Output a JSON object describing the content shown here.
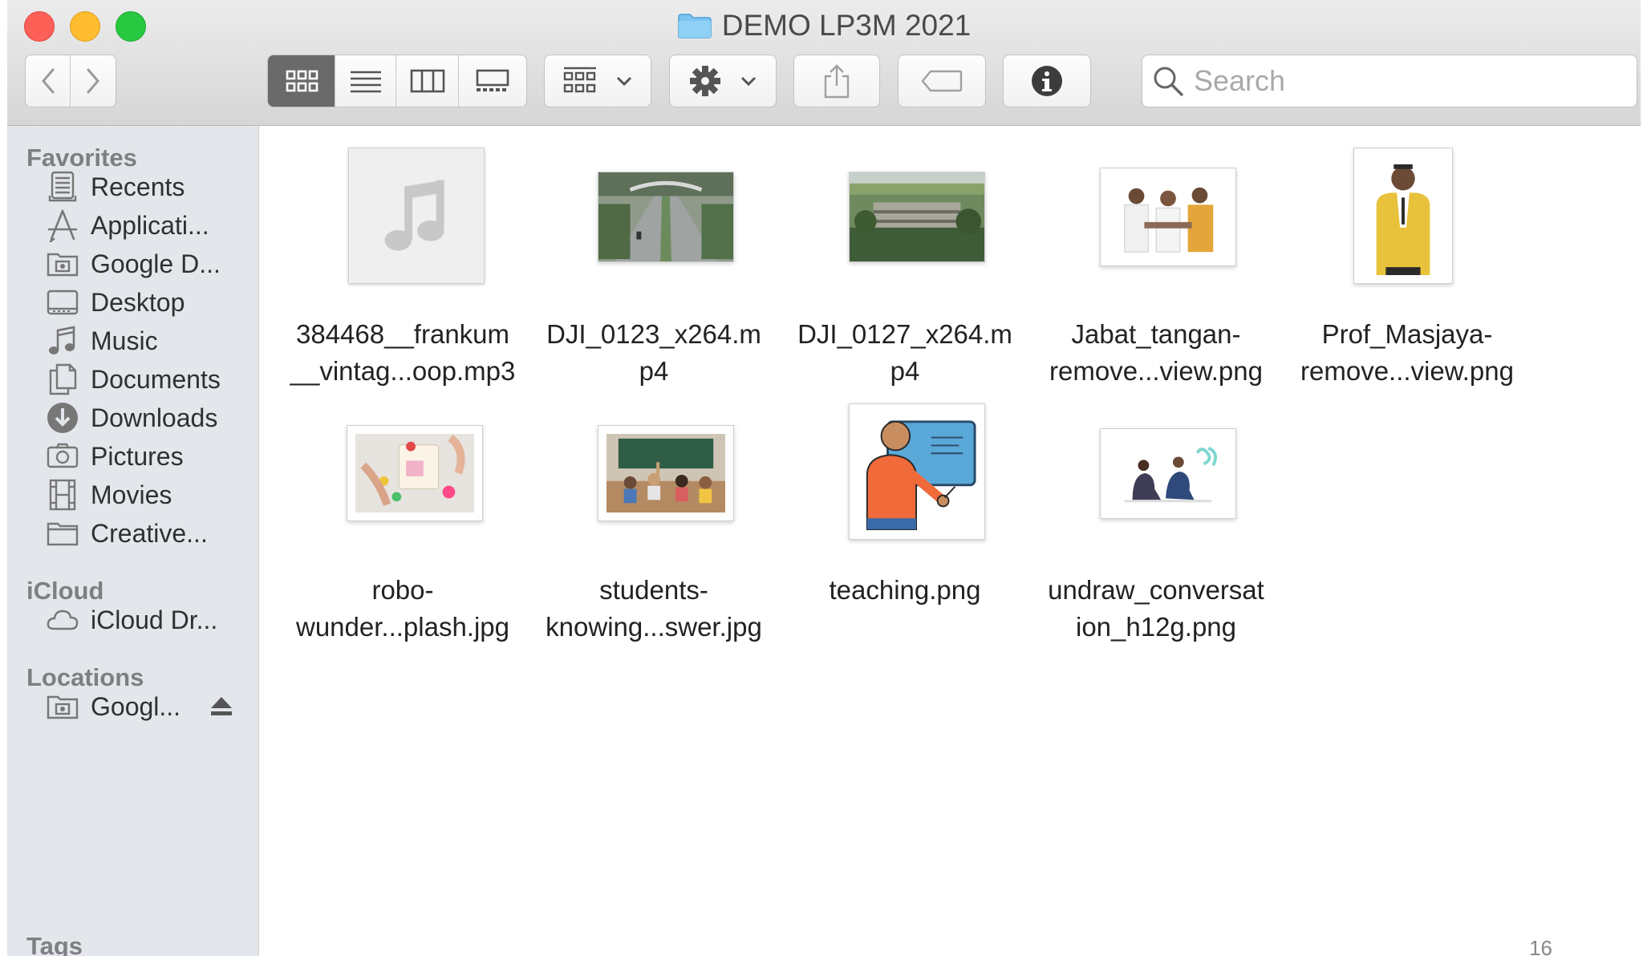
{
  "window": {
    "title": "DEMO LP3M 2021"
  },
  "toolbar": {
    "search_placeholder": "Search"
  },
  "sidebar": {
    "favorites_header": "Favorites",
    "favorites": [
      {
        "label": "Recents",
        "icon": "recents-icon"
      },
      {
        "label": "Applicati...",
        "icon": "applications-icon"
      },
      {
        "label": "Google D...",
        "icon": "drive-folder-icon"
      },
      {
        "label": "Desktop",
        "icon": "desktop-icon"
      },
      {
        "label": "Music",
        "icon": "music-note-icon"
      },
      {
        "label": "Documents",
        "icon": "documents-icon"
      },
      {
        "label": "Downloads",
        "icon": "downloads-icon"
      },
      {
        "label": "Pictures",
        "icon": "camera-icon"
      },
      {
        "label": "Movies",
        "icon": "film-icon"
      },
      {
        "label": "Creative...",
        "icon": "folder-icon"
      }
    ],
    "icloud_header": "iCloud",
    "icloud": [
      {
        "label": "iCloud Dr...",
        "icon": "cloud-icon"
      }
    ],
    "locations_header": "Locations",
    "locations": [
      {
        "label": "Googl...",
        "icon": "drive-folder-icon"
      }
    ],
    "tags_header": "Tags"
  },
  "files": [
    {
      "line1": "384468__frankum",
      "line2": "__vintag...oop.mp3",
      "kind": "audio"
    },
    {
      "line1": "DJI_0123_x264.m",
      "line2": "p4",
      "kind": "video-road"
    },
    {
      "line1": "DJI_0127_x264.m",
      "line2": "p4",
      "kind": "video-building"
    },
    {
      "line1": "Jabat_tangan-",
      "line2": "remove...view.png",
      "kind": "image-people"
    },
    {
      "line1": "Prof_Masjaya-",
      "line2": "remove...view.png",
      "kind": "image-portrait"
    },
    {
      "line1": "robo-",
      "line2": "wunder...plash.jpg",
      "kind": "image-robot"
    },
    {
      "line1": "students-",
      "line2": "knowing...swer.jpg",
      "kind": "image-classroom"
    },
    {
      "line1": "teaching.png",
      "line2": "",
      "kind": "image-teaching"
    },
    {
      "line1": "undraw_conversat",
      "line2": "ion_h12g.png",
      "kind": "image-conversation"
    }
  ],
  "page_number": "16"
}
